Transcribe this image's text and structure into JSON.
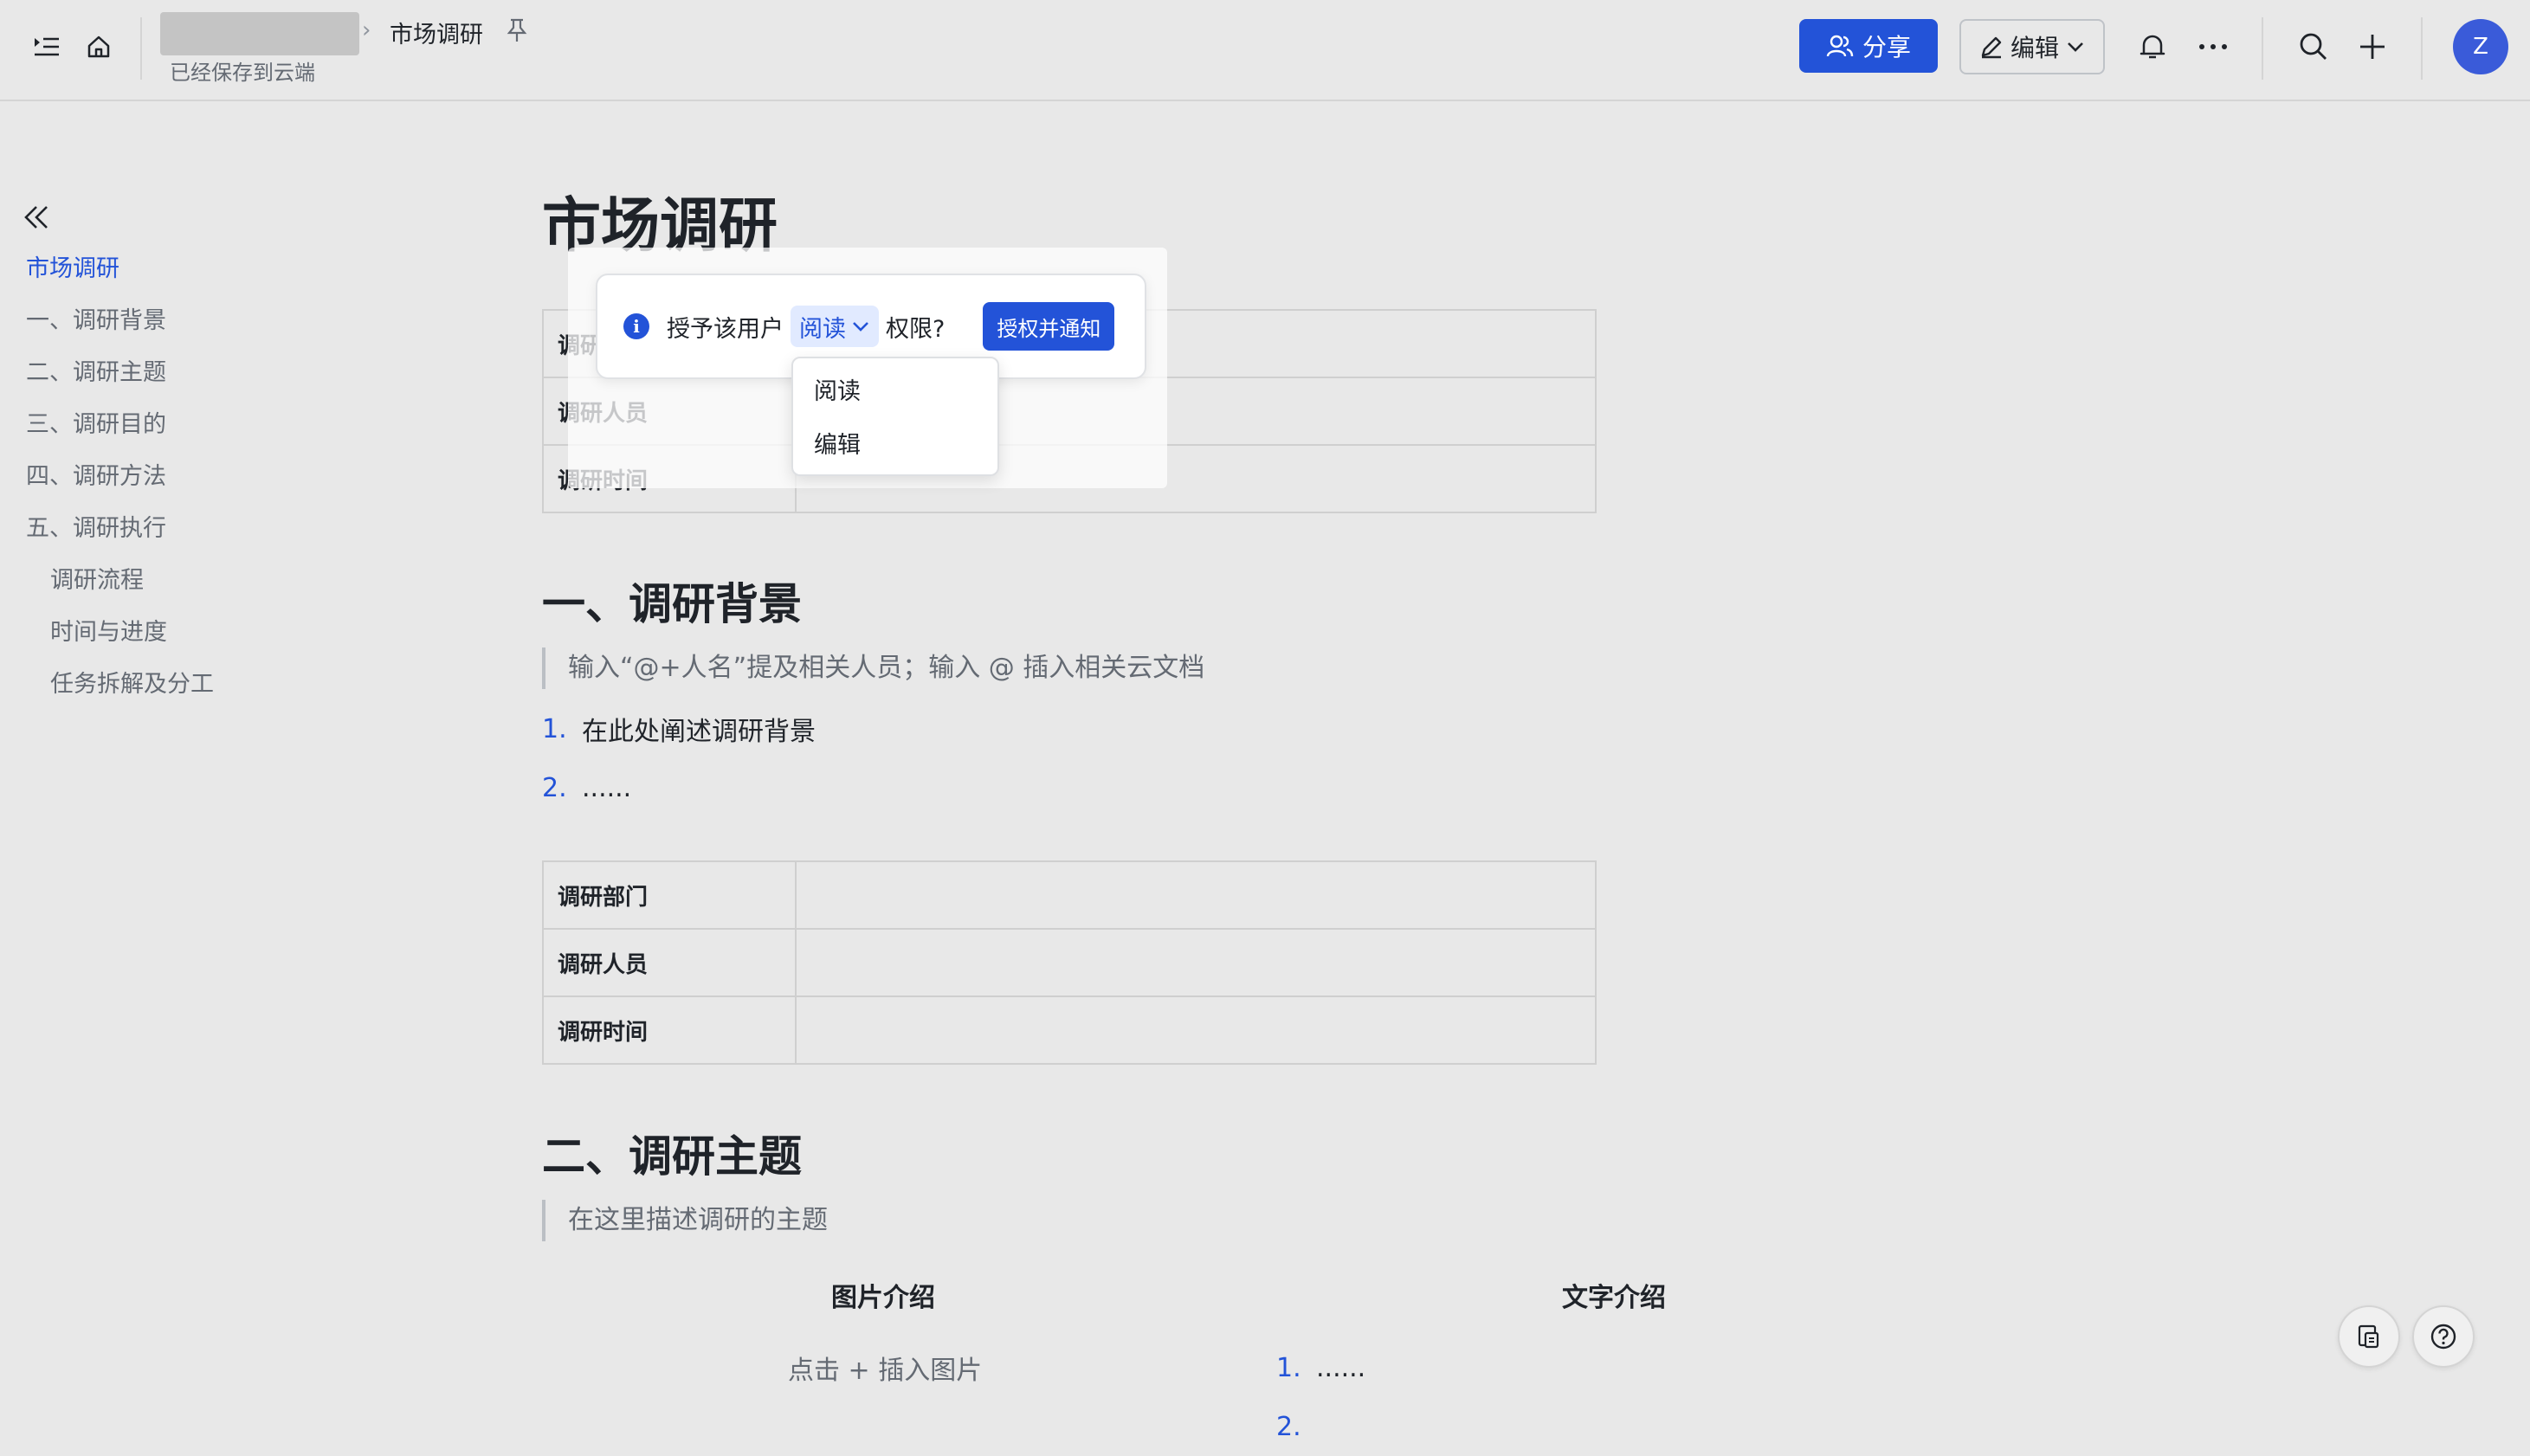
{
  "header": {
    "breadcrumb_title": "市场调研",
    "breadcrumb_separator": "›",
    "save_status": "已经保存到云端",
    "share_label": "分享",
    "edit_label": "编辑",
    "avatar_initial": "Z"
  },
  "outline": {
    "items": [
      {
        "label": "市场调研"
      },
      {
        "label": "一、调研背景"
      },
      {
        "label": "二、调研主题"
      },
      {
        "label": "三、调研目的"
      },
      {
        "label": "四、调研方法"
      },
      {
        "label": "五、调研执行"
      },
      {
        "label": "调研流程"
      },
      {
        "label": "时间与进度"
      },
      {
        "label": "任务拆解及分工"
      }
    ]
  },
  "doc": {
    "title": "市场调研",
    "table1": [
      {
        "key": "调研",
        "value": ""
      },
      {
        "key": "调研人员",
        "value": ""
      },
      {
        "key": "调研时间",
        "value": ""
      }
    ],
    "section1": {
      "heading": "一、调研背景",
      "quote": "输入“@+人名”提及相关人员；输入 @ 插入相关云文档",
      "list": [
        {
          "num": "1.",
          "text": "在此处阐述调研背景"
        },
        {
          "num": "2.",
          "text": "......"
        }
      ]
    },
    "table2": [
      {
        "key": "调研部门",
        "value": ""
      },
      {
        "key": "调研人员",
        "value": ""
      },
      {
        "key": "调研时间",
        "value": ""
      }
    ],
    "section2": {
      "heading": "二、调研主题",
      "quote": "在这里描述调研的主题",
      "left_col_title": "图片介绍",
      "left_col_hint": "点击 + 插入图片",
      "right_col_title": "文字介绍",
      "right_list": [
        {
          "num": "1.",
          "text": "......"
        },
        {
          "num": "2.",
          "text": ""
        }
      ]
    }
  },
  "permission_popup": {
    "info_icon_text": "i",
    "prefix": "授予该用户",
    "selected": "阅读",
    "suffix": "权限?",
    "confirm_label": "授权并通知",
    "options": [
      "阅读",
      "编辑"
    ]
  },
  "colors": {
    "accent": "#2353d8",
    "background": "#e8e8e8"
  }
}
